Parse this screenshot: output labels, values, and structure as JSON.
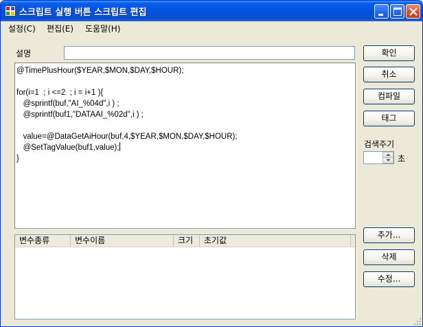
{
  "window": {
    "title": "스크립트 실행 버튼 스크립트 편집"
  },
  "menu": {
    "items": [
      "설정(C)",
      "편집(E)",
      "도움말(H)"
    ]
  },
  "description": {
    "label": "설명",
    "value": ""
  },
  "editor": {
    "lines": [
      "@TimePlusHour($YEAR,$MON,$DAY,$HOUR);",
      "",
      "for(i=1  ; i <=2  ; i = i+1 ){",
      "   @sprintf(buf,\"AI_%04d\",i ) ;",
      "   @sprintf(buf1,\"DATAAI_%02d\",i ) ;",
      "",
      "   value=@DataGetAiHour(buf,4,$YEAR,$MON,$DAY,$HOUR);",
      "   @SetTagValue(buf1,value);",
      "}"
    ]
  },
  "buttons": {
    "confirm": "확인",
    "cancel": "취소",
    "compile": "컴파일",
    "tag": "태그",
    "add": "추가...",
    "delete": "삭제",
    "edit": "수정..."
  },
  "search_period": {
    "label": "검색주기",
    "value": "",
    "unit": "초"
  },
  "variables_table": {
    "columns": [
      "변수종류",
      "변수이름",
      "크기",
      "초기값"
    ],
    "rows": []
  },
  "colors": {
    "titlebar": "#0454e0",
    "window_bg": "#ece9d8",
    "input_border": "#7f9db9",
    "button_border": "#003c74"
  }
}
